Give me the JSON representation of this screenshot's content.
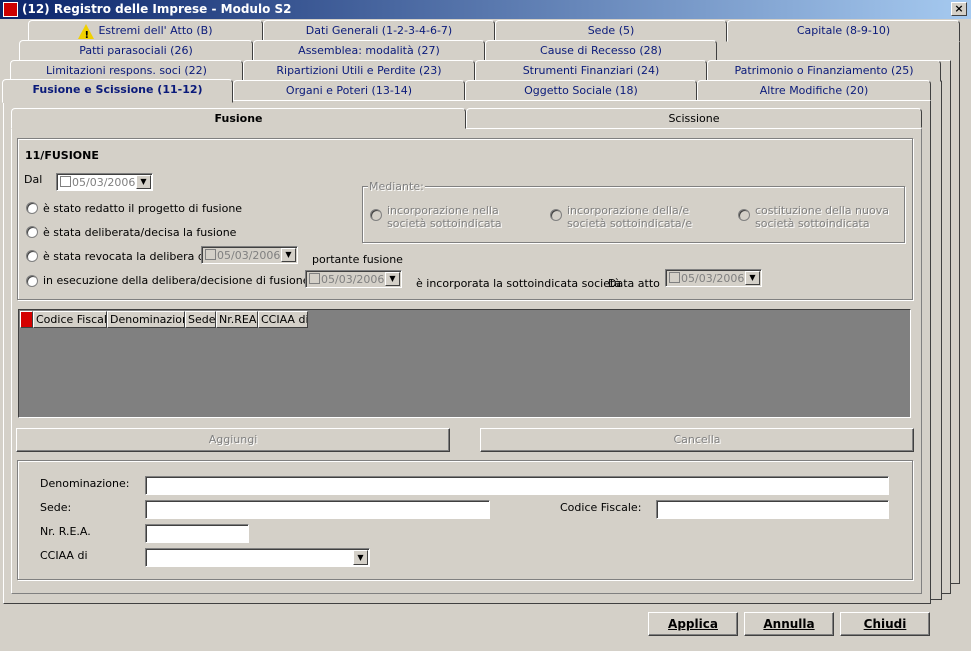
{
  "window": {
    "title": "(12) Registro delle Imprese - Modulo S2",
    "close_label": "×"
  },
  "tabs": {
    "row1": [
      "Estremi dell' Atto (B)",
      "Dati Generali (1-2-3-4-6-7)",
      "Sede (5)",
      "Capitale (8-9-10)"
    ],
    "row2": [
      "Patti parasociali (26)",
      "Assemblea: modalità (27)",
      "Cause di Recesso (28)"
    ],
    "row3": [
      "Limitazioni respons. soci (22)",
      "Ripartizioni Utili e Perdite (23)",
      "Strumenti Finanziari (24)",
      "Patrimonio o Finanziamento (25)"
    ],
    "row4": [
      "Fusione e Scissione (11-12)",
      "Organi e Poteri (13-14)",
      "Oggetto Sociale (18)",
      "Altre Modifiche (20)"
    ]
  },
  "subtabs": [
    "Fusione",
    "Scissione"
  ],
  "section": {
    "title": "11/FUSIONE",
    "dal_label": "Dal",
    "dal_date": "05/03/2006",
    "options": [
      "è stato redatto il progetto di fusione",
      "è stata deliberata/decisa la fusione",
      "è stata revocata la delibera del",
      "in esecuzione della delibera/decisione di fusione del"
    ],
    "revocata_date": "05/03/2006",
    "portante_label": "portante fusione",
    "esecuzione_date": "05/03/2006",
    "incorporata_label": "è incorporata la sottoindicata società",
    "data_atto_label": "Data atto",
    "data_atto_date": "05/03/2006",
    "mediante": {
      "label": "Mediante:",
      "options": [
        "incorporazione nella società sottoindicata",
        "incorporazione della/e società sottoindicata/e",
        "costituzione della nuova società sottoindicata"
      ]
    }
  },
  "grid": {
    "columns": [
      "Codice Fiscale",
      "Denominazione",
      "Sede",
      "Nr.REA",
      "CCIAA di"
    ]
  },
  "buttons": {
    "aggiungi": "Aggiungi",
    "cancella": "Cancella",
    "applica": "Applica",
    "annulla": "Annulla",
    "chiudi": "Chiudi"
  },
  "form": {
    "denominazione_label": "Denominazione:",
    "sede_label": "Sede:",
    "codice_fiscale_label": "Codice Fiscale:",
    "rea_label": "Nr. R.E.A.",
    "cciaa_label": "CCIAA di"
  }
}
